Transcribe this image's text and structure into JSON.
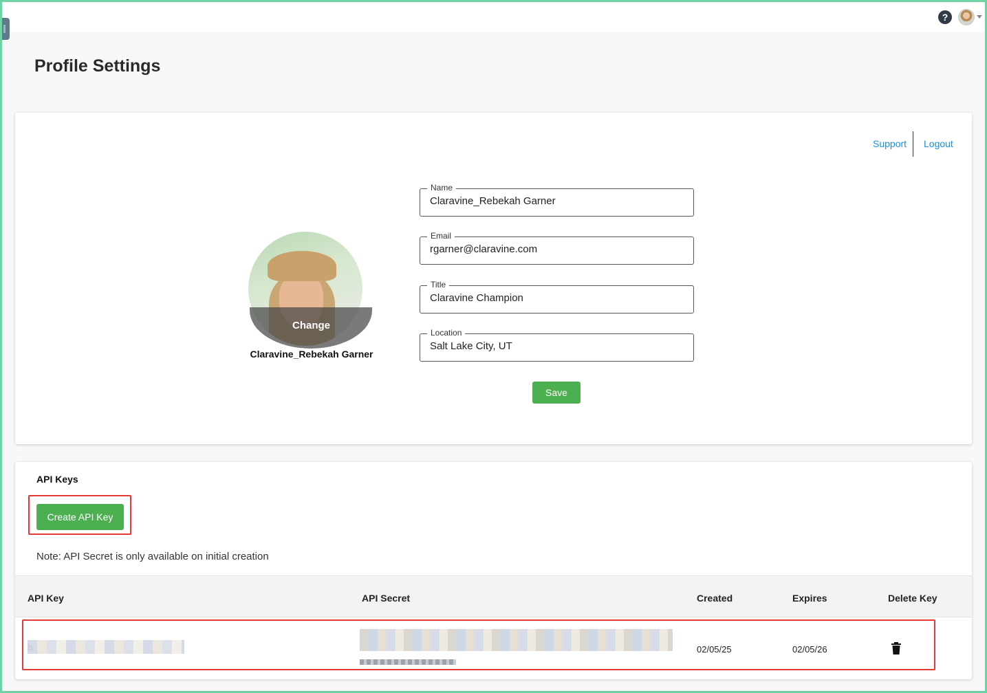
{
  "page": {
    "title": "Profile Settings"
  },
  "header": {
    "help_icon": "help-circle-icon",
    "avatar_icon": "user-avatar-icon"
  },
  "profile": {
    "support_label": "Support",
    "logout_label": "Logout",
    "avatar_change_label": "Change",
    "avatar_name": "Claravine_Rebekah Garner",
    "fields": {
      "name": {
        "label": "Name",
        "value": "Claravine_Rebekah Garner"
      },
      "email": {
        "label": "Email",
        "value": "rgarner@claravine.com"
      },
      "title": {
        "label": "Title",
        "value": "Claravine Champion"
      },
      "location": {
        "label": "Location",
        "value": "Salt Lake City, UT"
      }
    },
    "save_label": "Save"
  },
  "api_keys": {
    "title": "API Keys",
    "create_label": "Create API Key",
    "note": "Note: API Secret is only available on initial creation",
    "columns": [
      "API Key",
      "API Secret",
      "Created",
      "Expires",
      "Delete Key"
    ],
    "rows": [
      {
        "key_prefix": "b",
        "created": "02/05/25",
        "expires": "02/05/26",
        "delete_icon": "trash-icon"
      }
    ]
  },
  "colors": {
    "accent_green": "#4caf50",
    "link_blue": "#1a8ed8",
    "highlight_red": "#e53935",
    "frame_green": "#6ed3a5"
  }
}
